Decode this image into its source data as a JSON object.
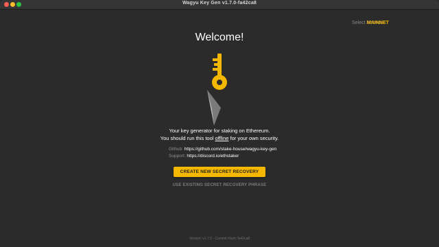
{
  "window": {
    "title": "Wagyu Key Gen v1.7.0-fa42ca8"
  },
  "network": {
    "label": "Select Network:",
    "value": "MAINNET"
  },
  "main": {
    "heading": "Welcome!",
    "tagline_line1": "Your key generator for staking on Ethereum.",
    "tagline_line2_before": "You should run this tool ",
    "tagline_line2_emphasis": "offline",
    "tagline_line2_after": " for your own security.",
    "links": [
      {
        "label": "Github:",
        "url": "https://github.com/stake-house/wagyu-key-gen"
      },
      {
        "label": "Support:",
        "url": "https://discord.io/ethstaker"
      }
    ],
    "create_button": "CREATE NEW SECRET RECOVERY PHRASE",
    "use_existing_button": "USE EXISTING SECRET RECOVERY PHRASE"
  },
  "footer": {
    "version_text": "Version: v1.7.0 - Commit Hash: fa42ca8"
  },
  "colors": {
    "accent": "#f5b800",
    "background": "#2b2b2b"
  },
  "icons": {
    "logo": "key-icon",
    "logo_secondary": "ethereum-shard-icon"
  }
}
